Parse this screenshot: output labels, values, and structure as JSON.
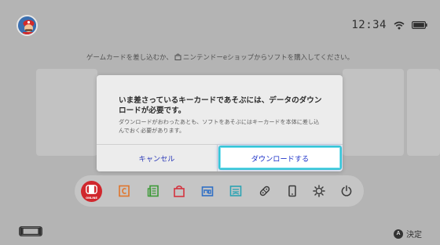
{
  "status": {
    "time": "12:34"
  },
  "home": {
    "hint_before": "ゲームカードを差し込むか、",
    "hint_after": "ニンテンドーeショップからソフトを購入してください。"
  },
  "dock": {
    "online_label": "ONLINE",
    "icons": [
      "nintendo-switch-online",
      "news",
      "eshop",
      "album",
      "controllers",
      "settings",
      "power"
    ]
  },
  "footer": {
    "button": "A",
    "action": "決定"
  },
  "dialog": {
    "title": "いま差さっているキーカードであそぶには、データのダウンロードが必要です。",
    "description": "ダウンロードがおわったあとも、ソフトをあそぶにはキーカードを本体に差し込んでおく必要があります。",
    "cancel_label": "キャンセル",
    "confirm_label": "ダウンロードする"
  },
  "colors": {
    "online_red": "#d0272d",
    "dialog_link": "#2d3bb8",
    "focus_border": "#35c4d6",
    "icon_orange": "#e0752b",
    "icon_green": "#3c9a37",
    "icon_red": "#d4323e",
    "icon_blue": "#2f6fc5",
    "icon_teal": "#2ba3b3"
  }
}
